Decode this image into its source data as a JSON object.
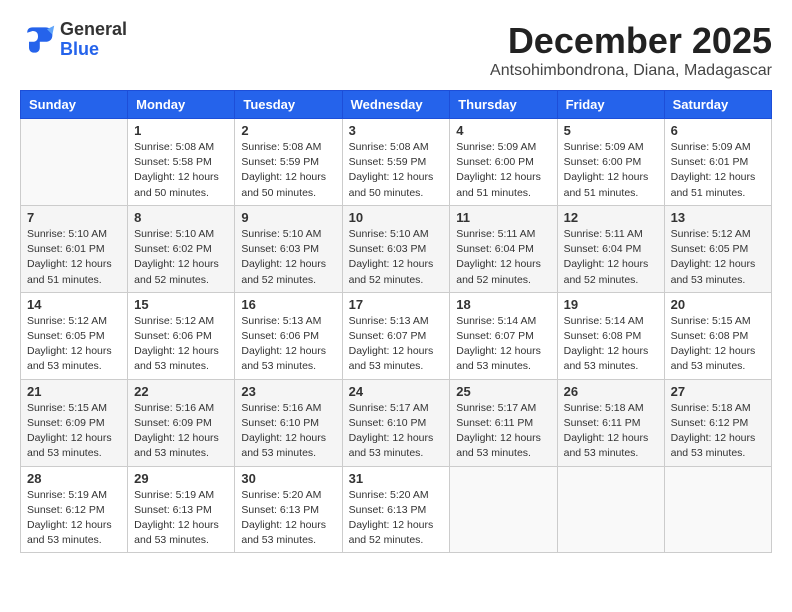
{
  "header": {
    "logo_general": "General",
    "logo_blue": "Blue",
    "month": "December 2025",
    "location": "Antsohimbondrona, Diana, Madagascar"
  },
  "days_of_week": [
    "Sunday",
    "Monday",
    "Tuesday",
    "Wednesday",
    "Thursday",
    "Friday",
    "Saturday"
  ],
  "weeks": [
    [
      {
        "day": "",
        "sunrise": "",
        "sunset": "",
        "daylight": ""
      },
      {
        "day": "1",
        "sunrise": "Sunrise: 5:08 AM",
        "sunset": "Sunset: 5:58 PM",
        "daylight": "Daylight: 12 hours and 50 minutes."
      },
      {
        "day": "2",
        "sunrise": "Sunrise: 5:08 AM",
        "sunset": "Sunset: 5:59 PM",
        "daylight": "Daylight: 12 hours and 50 minutes."
      },
      {
        "day": "3",
        "sunrise": "Sunrise: 5:08 AM",
        "sunset": "Sunset: 5:59 PM",
        "daylight": "Daylight: 12 hours and 50 minutes."
      },
      {
        "day": "4",
        "sunrise": "Sunrise: 5:09 AM",
        "sunset": "Sunset: 6:00 PM",
        "daylight": "Daylight: 12 hours and 51 minutes."
      },
      {
        "day": "5",
        "sunrise": "Sunrise: 5:09 AM",
        "sunset": "Sunset: 6:00 PM",
        "daylight": "Daylight: 12 hours and 51 minutes."
      },
      {
        "day": "6",
        "sunrise": "Sunrise: 5:09 AM",
        "sunset": "Sunset: 6:01 PM",
        "daylight": "Daylight: 12 hours and 51 minutes."
      }
    ],
    [
      {
        "day": "7",
        "sunrise": "Sunrise: 5:10 AM",
        "sunset": "Sunset: 6:01 PM",
        "daylight": "Daylight: 12 hours and 51 minutes."
      },
      {
        "day": "8",
        "sunrise": "Sunrise: 5:10 AM",
        "sunset": "Sunset: 6:02 PM",
        "daylight": "Daylight: 12 hours and 52 minutes."
      },
      {
        "day": "9",
        "sunrise": "Sunrise: 5:10 AM",
        "sunset": "Sunset: 6:03 PM",
        "daylight": "Daylight: 12 hours and 52 minutes."
      },
      {
        "day": "10",
        "sunrise": "Sunrise: 5:10 AM",
        "sunset": "Sunset: 6:03 PM",
        "daylight": "Daylight: 12 hours and 52 minutes."
      },
      {
        "day": "11",
        "sunrise": "Sunrise: 5:11 AM",
        "sunset": "Sunset: 6:04 PM",
        "daylight": "Daylight: 12 hours and 52 minutes."
      },
      {
        "day": "12",
        "sunrise": "Sunrise: 5:11 AM",
        "sunset": "Sunset: 6:04 PM",
        "daylight": "Daylight: 12 hours and 52 minutes."
      },
      {
        "day": "13",
        "sunrise": "Sunrise: 5:12 AM",
        "sunset": "Sunset: 6:05 PM",
        "daylight": "Daylight: 12 hours and 53 minutes."
      }
    ],
    [
      {
        "day": "14",
        "sunrise": "Sunrise: 5:12 AM",
        "sunset": "Sunset: 6:05 PM",
        "daylight": "Daylight: 12 hours and 53 minutes."
      },
      {
        "day": "15",
        "sunrise": "Sunrise: 5:12 AM",
        "sunset": "Sunset: 6:06 PM",
        "daylight": "Daylight: 12 hours and 53 minutes."
      },
      {
        "day": "16",
        "sunrise": "Sunrise: 5:13 AM",
        "sunset": "Sunset: 6:06 PM",
        "daylight": "Daylight: 12 hours and 53 minutes."
      },
      {
        "day": "17",
        "sunrise": "Sunrise: 5:13 AM",
        "sunset": "Sunset: 6:07 PM",
        "daylight": "Daylight: 12 hours and 53 minutes."
      },
      {
        "day": "18",
        "sunrise": "Sunrise: 5:14 AM",
        "sunset": "Sunset: 6:07 PM",
        "daylight": "Daylight: 12 hours and 53 minutes."
      },
      {
        "day": "19",
        "sunrise": "Sunrise: 5:14 AM",
        "sunset": "Sunset: 6:08 PM",
        "daylight": "Daylight: 12 hours and 53 minutes."
      },
      {
        "day": "20",
        "sunrise": "Sunrise: 5:15 AM",
        "sunset": "Sunset: 6:08 PM",
        "daylight": "Daylight: 12 hours and 53 minutes."
      }
    ],
    [
      {
        "day": "21",
        "sunrise": "Sunrise: 5:15 AM",
        "sunset": "Sunset: 6:09 PM",
        "daylight": "Daylight: 12 hours and 53 minutes."
      },
      {
        "day": "22",
        "sunrise": "Sunrise: 5:16 AM",
        "sunset": "Sunset: 6:09 PM",
        "daylight": "Daylight: 12 hours and 53 minutes."
      },
      {
        "day": "23",
        "sunrise": "Sunrise: 5:16 AM",
        "sunset": "Sunset: 6:10 PM",
        "daylight": "Daylight: 12 hours and 53 minutes."
      },
      {
        "day": "24",
        "sunrise": "Sunrise: 5:17 AM",
        "sunset": "Sunset: 6:10 PM",
        "daylight": "Daylight: 12 hours and 53 minutes."
      },
      {
        "day": "25",
        "sunrise": "Sunrise: 5:17 AM",
        "sunset": "Sunset: 6:11 PM",
        "daylight": "Daylight: 12 hours and 53 minutes."
      },
      {
        "day": "26",
        "sunrise": "Sunrise: 5:18 AM",
        "sunset": "Sunset: 6:11 PM",
        "daylight": "Daylight: 12 hours and 53 minutes."
      },
      {
        "day": "27",
        "sunrise": "Sunrise: 5:18 AM",
        "sunset": "Sunset: 6:12 PM",
        "daylight": "Daylight: 12 hours and 53 minutes."
      }
    ],
    [
      {
        "day": "28",
        "sunrise": "Sunrise: 5:19 AM",
        "sunset": "Sunset: 6:12 PM",
        "daylight": "Daylight: 12 hours and 53 minutes."
      },
      {
        "day": "29",
        "sunrise": "Sunrise: 5:19 AM",
        "sunset": "Sunset: 6:13 PM",
        "daylight": "Daylight: 12 hours and 53 minutes."
      },
      {
        "day": "30",
        "sunrise": "Sunrise: 5:20 AM",
        "sunset": "Sunset: 6:13 PM",
        "daylight": "Daylight: 12 hours and 53 minutes."
      },
      {
        "day": "31",
        "sunrise": "Sunrise: 5:20 AM",
        "sunset": "Sunset: 6:13 PM",
        "daylight": "Daylight: 12 hours and 52 minutes."
      },
      {
        "day": "",
        "sunrise": "",
        "sunset": "",
        "daylight": ""
      },
      {
        "day": "",
        "sunrise": "",
        "sunset": "",
        "daylight": ""
      },
      {
        "day": "",
        "sunrise": "",
        "sunset": "",
        "daylight": ""
      }
    ]
  ]
}
